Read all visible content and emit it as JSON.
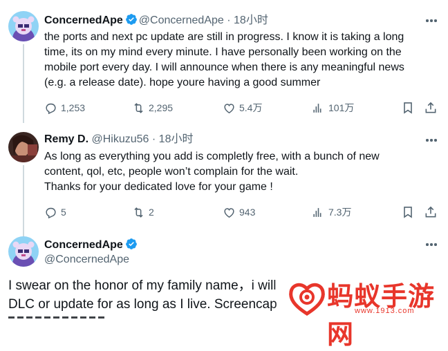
{
  "tweets": [
    {
      "name": "ConcernedApe",
      "verified": true,
      "handle": "@ConcernedApe",
      "dot": "·",
      "time": "18小时",
      "text": "the ports and next pc update are still in progress. I know it is taking a long\ntime, its on my mind every minute. I have personally been working on the\nmobile port every day. I will announce when there is any meaningful news\n(e.g. a release date). hope youre having a good summer",
      "replies": "1,253",
      "reposts": "2,295",
      "likes": "5.4万",
      "views": "101万"
    },
    {
      "name": "Remy D.",
      "verified": false,
      "handle": "@Hikuzu56",
      "dot": "·",
      "time": "18小时",
      "text": "As long as everything you add is completly free, with a bunch of new\ncontent, qol, etc, people won’t complain for the wait.\nThanks for your dedicated love for your game !",
      "replies": "5",
      "reposts": "2",
      "likes": "943",
      "views": "7.3万"
    },
    {
      "name": "ConcernedApe",
      "verified": true,
      "handle": "@ConcernedApe",
      "text_line1": "I swear on the honor of my family name，i will",
      "text_line2": "DLC or update for as long as I live. Screencap"
    }
  ],
  "watermark": {
    "title": "蚂蚁手游网",
    "url": "www.1913.com"
  },
  "colors": {
    "text": "#0f1419",
    "secondary": "#536471",
    "verified": "#1d9bf0",
    "thread_line": "#cfd9de",
    "watermark": "#e8362b"
  },
  "icons": [
    "verified-badge-icon",
    "more-icon",
    "reply-icon",
    "repost-icon",
    "like-icon",
    "views-icon",
    "bookmark-icon",
    "share-icon"
  ]
}
